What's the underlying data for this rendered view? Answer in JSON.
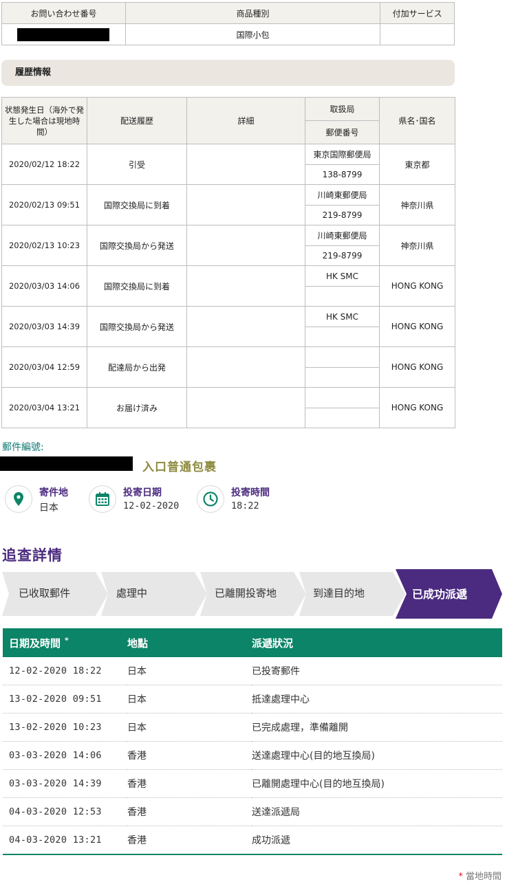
{
  "summary": {
    "headers": [
      "お問い合わせ番号",
      "商品種別",
      "付加サービス"
    ],
    "product_type": "国際小包",
    "additional_service": ""
  },
  "history_header": "履歴情報",
  "history": {
    "col_date": "状態発生日（海外で発生した場合は現地時間）",
    "col_status": "配送履歴",
    "col_detail": "詳細",
    "col_office": "取扱局",
    "col_postal": "郵便番号",
    "col_region": "県名･国名",
    "rows": [
      {
        "date": "2020/02/12 18:22",
        "status": "引受",
        "detail": "",
        "office": "東京国際郵便局",
        "postal": "138-8799",
        "region": "東京都"
      },
      {
        "date": "2020/02/13 09:51",
        "status": "国際交換局に到着",
        "detail": "",
        "office": "川崎東郵便局",
        "postal": "219-8799",
        "region": "神奈川県"
      },
      {
        "date": "2020/02/13 10:23",
        "status": "国際交換局から発送",
        "detail": "",
        "office": "川崎東郵便局",
        "postal": "219-8799",
        "region": "神奈川県"
      },
      {
        "date": "2020/03/03 14:06",
        "status": "国際交換局に到着",
        "detail": "",
        "office": "HK SMC",
        "postal": "",
        "region": "HONG KONG"
      },
      {
        "date": "2020/03/03 14:39",
        "status": "国際交換局から発送",
        "detail": "",
        "office": "HK SMC",
        "postal": "",
        "region": "HONG KONG"
      },
      {
        "date": "2020/03/04 12:59",
        "status": "配達局から出発",
        "detail": "",
        "office": "",
        "postal": "",
        "region": "HONG KONG"
      },
      {
        "date": "2020/03/04 13:21",
        "status": "お届け済み",
        "detail": "",
        "office": "",
        "postal": "",
        "region": "HONG KONG"
      }
    ]
  },
  "hk": {
    "mail_label": "郵件編號:",
    "mail_type": "入口普通包裹",
    "origin_title": "寄件地",
    "origin_value": "日本",
    "post_date_title": "投寄日期",
    "post_date_value": "12-02-2020",
    "post_time_title": "投寄時間",
    "post_time_value": "18:22",
    "track_title": "追查詳情",
    "steps": [
      "已收取郵件",
      "處理中",
      "已離開投寄地",
      "到達目的地",
      "已成功派遞"
    ],
    "active_step": 4,
    "colors": {
      "purple": "#4b2b7f",
      "green": "#0c8467",
      "teal": "#0f7a73",
      "step_bg": "#e7e7e7"
    },
    "table_headers": {
      "datetime": "日期及時間",
      "star": "*",
      "location": "地點",
      "status": "派遞狀況"
    },
    "rows": [
      {
        "datetime": "12-02-2020 18:22",
        "location": "日本",
        "status": "已投寄郵件"
      },
      {
        "datetime": "13-02-2020 09:51",
        "location": "日本",
        "status": "抵達處理中心"
      },
      {
        "datetime": "13-02-2020 10:23",
        "location": "日本",
        "status": "已完成處理，準備離開"
      },
      {
        "datetime": "03-03-2020 14:06",
        "location": "香港",
        "status": "送達處理中心(目的地互換局)"
      },
      {
        "datetime": "03-03-2020 14:39",
        "location": "香港",
        "status": "已離開處理中心(目的地互換局)"
      },
      {
        "datetime": "04-03-2020 12:53",
        "location": "香港",
        "status": "送達派遞局"
      },
      {
        "datetime": "04-03-2020 13:21",
        "location": "香港",
        "status": "成功派遞"
      }
    ],
    "footnote_star": "*",
    "footnote": "當地時間"
  }
}
